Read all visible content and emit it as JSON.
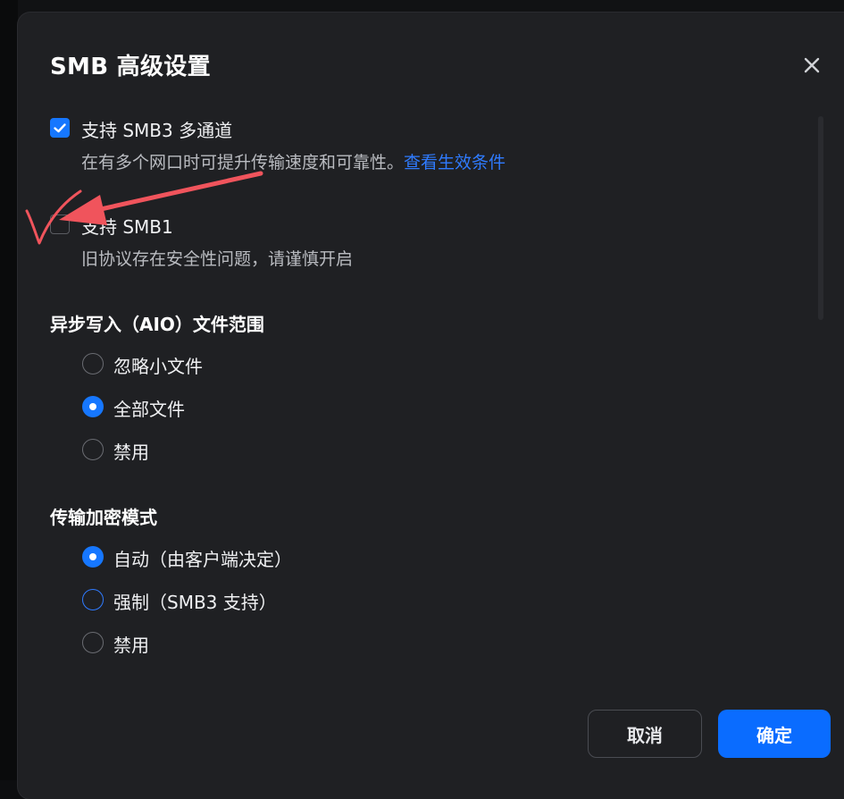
{
  "dialog": {
    "title": "SMB 高级设置",
    "close_icon": "close-icon"
  },
  "options": {
    "multichannel": {
      "checked": true,
      "label": "支持 SMB3 多通道",
      "desc": "在有多个网口时可提升传输速度和可靠性。",
      "link": "查看生效条件"
    },
    "smb1": {
      "checked": false,
      "label": "支持 SMB1",
      "desc": "旧协议存在安全性问题，请谨慎开启"
    }
  },
  "aio": {
    "title": "异步写入（AIO）文件范围",
    "options": [
      {
        "label": "忽略小文件",
        "selected": false
      },
      {
        "label": "全部文件",
        "selected": true
      },
      {
        "label": "禁用",
        "selected": false
      }
    ]
  },
  "encryption": {
    "title": "传输加密模式",
    "options": [
      {
        "label": "自动（由客户端决定）",
        "selected": true
      },
      {
        "label": "强制（SMB3 支持）",
        "selected": false
      },
      {
        "label": "禁用",
        "selected": false
      }
    ]
  },
  "footer": {
    "cancel_label": "取消",
    "confirm_label": "确定"
  },
  "colors": {
    "accent": "#1677ff",
    "link": "#2f7bff",
    "annotation": "#f0545c",
    "dialog_bg": "#1f2023"
  }
}
